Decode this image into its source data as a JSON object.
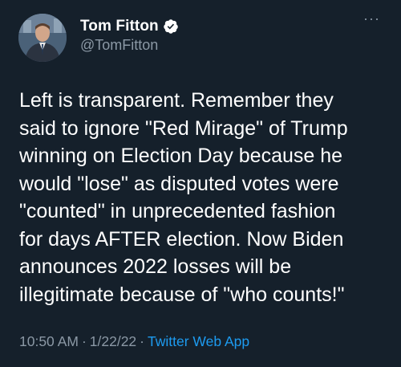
{
  "author": {
    "display_name": "Tom Fitton",
    "handle": "@TomFitton",
    "verified": true,
    "avatar_icon": "profile-photo-icon"
  },
  "menu": {
    "more_label": "···"
  },
  "tweet": {
    "text": "Left is transparent. Remember they\nsaid to ignore \"Red Mirage\" of Trump\nwinning on Election Day because he\nwould \"lose\" as disputed votes were\n\"counted\" in unprecedented fashion\nfor days AFTER election. Now Biden\nannounces 2022 losses will be\nillegitimate because of \"who counts!\""
  },
  "meta": {
    "time": "10:50 AM",
    "separator": "·",
    "date": "1/22/22",
    "source": "Twitter Web App"
  },
  "colors": {
    "background": "#15202b",
    "text": "#ffffff",
    "secondary": "#8b98a5",
    "accent": "#1d9bf0"
  }
}
